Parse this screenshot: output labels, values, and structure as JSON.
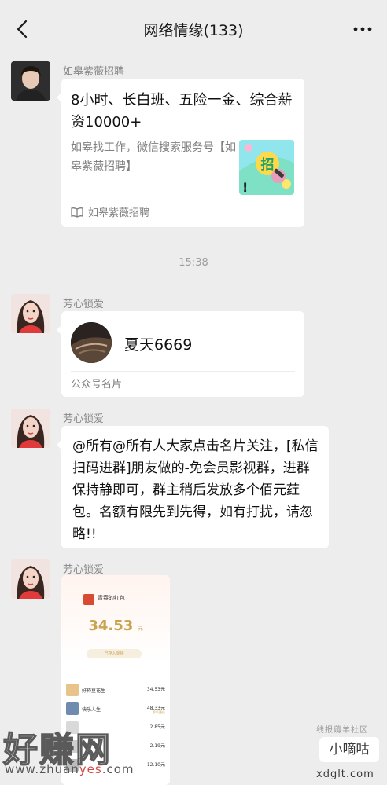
{
  "header": {
    "title": "网络情缘(133)",
    "back_icon": "chevron-left-icon",
    "more_icon": "more-dots-icon"
  },
  "messages": {
    "m1": {
      "sender": "如皋紫薇招聘",
      "article_title": "8小时、长白班、五险一金、综合薪资10000+",
      "article_desc": "如皋找工作，微信搜索服务号【如皋紫薇招聘】",
      "thumb_char": "招",
      "source_icon": "book-open-icon",
      "source_name": "如皋紫薇招聘"
    },
    "timestamp": "15:38",
    "m2": {
      "sender": "芳心锁爱",
      "card_name": "夏天6669",
      "card_type": "公众号名片"
    },
    "m3": {
      "sender": "芳心锁爱",
      "text": "@所有@所有人大家点击名片关注，[私信扫码进群]朋友做的-免会员影视群，进群保持静即可，群主稍后发放多个佰元荭包。名额有限先到先得，如有打扰，请忽略!!"
    },
    "m4": {
      "sender": "芳心锁爱",
      "shot": {
        "title": "青春的红包",
        "amount": "34.53",
        "unit": "元",
        "button": "已存入零钱",
        "rows": [
          {
            "name": "好柿豆花生",
            "amount": "34.53元"
          },
          {
            "name": "快乐人生",
            "amount": "48.33元",
            "tag": "手气最佳"
          },
          {
            "name": "",
            "amount": "2.85元"
          },
          {
            "name": "",
            "amount": "2.19元"
          },
          {
            "name": "",
            "amount": "12.10元"
          }
        ]
      }
    }
  },
  "watermark": {
    "left_big": "好赚网",
    "left_url_a": "www.zhuan",
    "left_url_b": "yes",
    "left_url_c": ".com",
    "right_top": "线报薅羊社区",
    "right_mid": "小嘀咕",
    "right_bottom": "xdglt.com"
  }
}
